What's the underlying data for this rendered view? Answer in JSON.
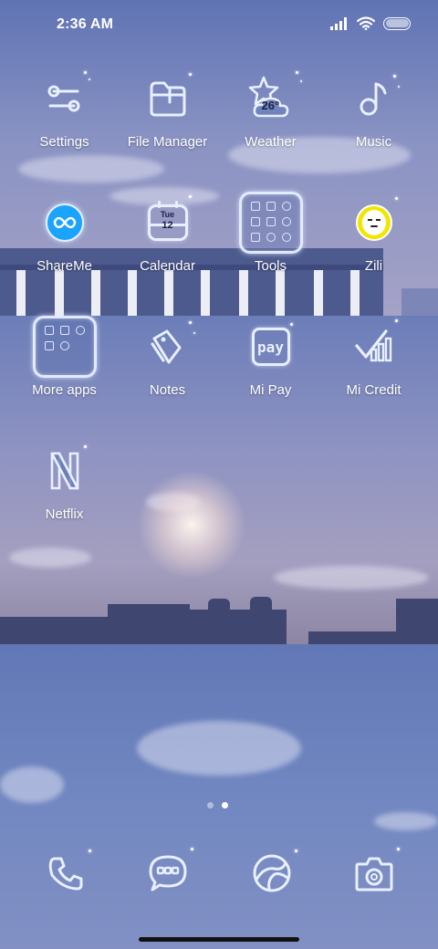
{
  "status_bar": {
    "time": "2:36 AM",
    "icons": [
      "signal-icon",
      "wifi-icon",
      "battery-icon"
    ]
  },
  "apps": [
    {
      "label": "Settings",
      "icon": "settings-sliders-icon"
    },
    {
      "label": "File Manager",
      "icon": "folder-icon"
    },
    {
      "label": "Weather",
      "icon": "weather-icon",
      "temperature": "26°"
    },
    {
      "label": "Music",
      "icon": "music-note-icon"
    },
    {
      "label": "ShareMe",
      "icon": "shareme-icon"
    },
    {
      "label": "Calendar",
      "icon": "calendar-icon",
      "weekday": "Tue",
      "day": "12"
    },
    {
      "label": "Tools",
      "icon": "tools-folder-icon"
    },
    {
      "label": "Zili",
      "icon": "zili-icon"
    },
    {
      "label": "More apps",
      "icon": "more-apps-folder-icon"
    },
    {
      "label": "Notes",
      "icon": "notes-tag-icon"
    },
    {
      "label": "Mi Pay",
      "icon": "mi-pay-icon",
      "icon_text": "pay"
    },
    {
      "label": "Mi Credit",
      "icon": "mi-credit-icon"
    },
    {
      "label": "Netflix",
      "icon": "netflix-icon"
    }
  ],
  "page_indicator": {
    "pages": 2,
    "current": 2
  },
  "dock": [
    {
      "icon": "phone-icon"
    },
    {
      "icon": "messages-icon"
    },
    {
      "icon": "browser-icon"
    },
    {
      "icon": "camera-icon"
    }
  ],
  "colors": {
    "icon_glow": "#e8f0ff",
    "shareme_blue": "#1aa3ff",
    "zili_yellow": "#f2e600"
  }
}
